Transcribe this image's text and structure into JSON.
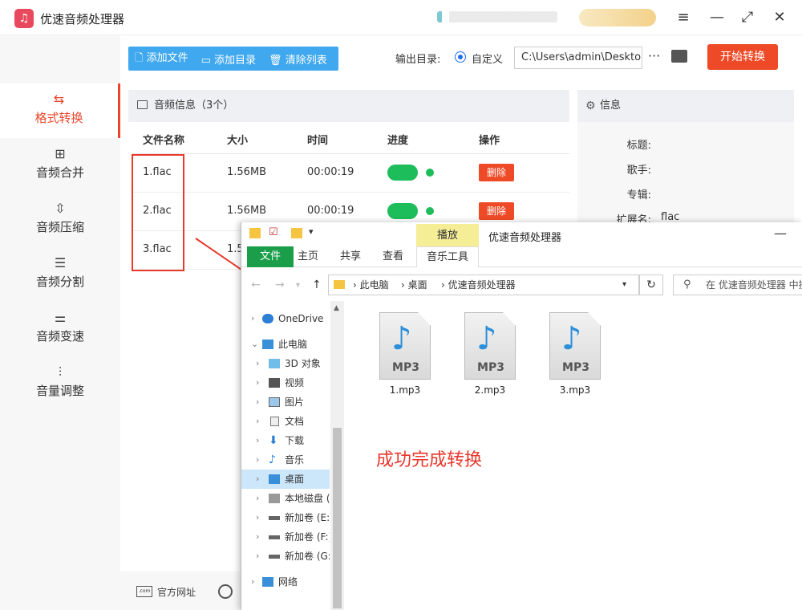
{
  "app": {
    "title": "优速音频处理器",
    "logo_icon": "headphones-icon",
    "window_controls": [
      "menu-icon",
      "minimize-icon",
      "maximize-icon",
      "close-icon"
    ]
  },
  "sidebar": {
    "items": [
      {
        "label": "格式转换",
        "icon": "convert-icon",
        "active": true
      },
      {
        "label": "音频合并",
        "icon": "merge-icon",
        "active": false
      },
      {
        "label": "音频压缩",
        "icon": "compress-icon",
        "active": false
      },
      {
        "label": "音频分割",
        "icon": "split-icon",
        "active": false
      },
      {
        "label": "音频变速",
        "icon": "speed-icon",
        "active": false
      },
      {
        "label": "音量调整",
        "icon": "volume-icon",
        "active": false
      }
    ]
  },
  "toolbar": {
    "add_file": "添加文件",
    "add_dir": "添加目录",
    "clear_list": "清除列表",
    "output_label": "输出目录:",
    "output_option": "自定义",
    "output_path": "C:\\Users\\admin\\Deskto",
    "more": "···",
    "start": "开始转换"
  },
  "list": {
    "header": "音频信息（3个）",
    "columns": {
      "name": "文件名称",
      "size": "大小",
      "time": "时间",
      "progress": "进度",
      "action": "操作"
    },
    "rows": [
      {
        "name": "1.flac",
        "size": "1.56MB",
        "time": "00:00:19",
        "action": "删除"
      },
      {
        "name": "2.flac",
        "size": "1.56MB",
        "time": "00:00:19",
        "action": "删除"
      },
      {
        "name": "3.flac",
        "size": "1.5",
        "time": "",
        "action": ""
      }
    ]
  },
  "info": {
    "header": "信息",
    "labels": {
      "title": "标题:",
      "artist": "歌手:",
      "album": "专辑:",
      "ext": "扩展名:"
    },
    "ext_value": "flac"
  },
  "footer": {
    "website": "官方网址"
  },
  "explorer": {
    "play_tab": "播放",
    "title": "优速音频处理器",
    "tabs": {
      "file": "文件",
      "home": "主页",
      "share": "共享",
      "view": "查看",
      "music_tools": "音乐工具"
    },
    "breadcrumb": [
      "此电脑",
      "桌面",
      "优速音频处理器"
    ],
    "search_placeholder": "在 优速音频处理器 中搜",
    "tree": [
      {
        "label": "OneDrive",
        "icon": "cloud-icon"
      },
      {
        "label": "此电脑",
        "icon": "computer-icon"
      },
      {
        "label": "3D 对象",
        "icon": "cube-icon"
      },
      {
        "label": "视频",
        "icon": "video-icon"
      },
      {
        "label": "图片",
        "icon": "picture-icon"
      },
      {
        "label": "文档",
        "icon": "document-icon"
      },
      {
        "label": "下载",
        "icon": "download-icon"
      },
      {
        "label": "音乐",
        "icon": "music-icon"
      },
      {
        "label": "桌面",
        "icon": "desktop-icon"
      },
      {
        "label": "本地磁盘 (",
        "icon": "disk-icon"
      },
      {
        "label": "新加卷 (E:)",
        "icon": "drive-icon"
      },
      {
        "label": "新加卷 (F:)",
        "icon": "drive-icon"
      },
      {
        "label": "新加卷 (G:",
        "icon": "drive-icon"
      },
      {
        "label": "网络",
        "icon": "network-icon"
      }
    ],
    "files": [
      {
        "name": "1.mp3",
        "badge": "MP3"
      },
      {
        "name": "2.mp3",
        "badge": "MP3"
      },
      {
        "name": "3.mp3",
        "badge": "MP3"
      }
    ],
    "annotation": "成功完成转换"
  },
  "colors": {
    "accent": "#ef4a27",
    "toolbar_blue": "#3fa8ee",
    "progress_green": "#1cbd5a",
    "annotation_red": "#e8372c"
  }
}
